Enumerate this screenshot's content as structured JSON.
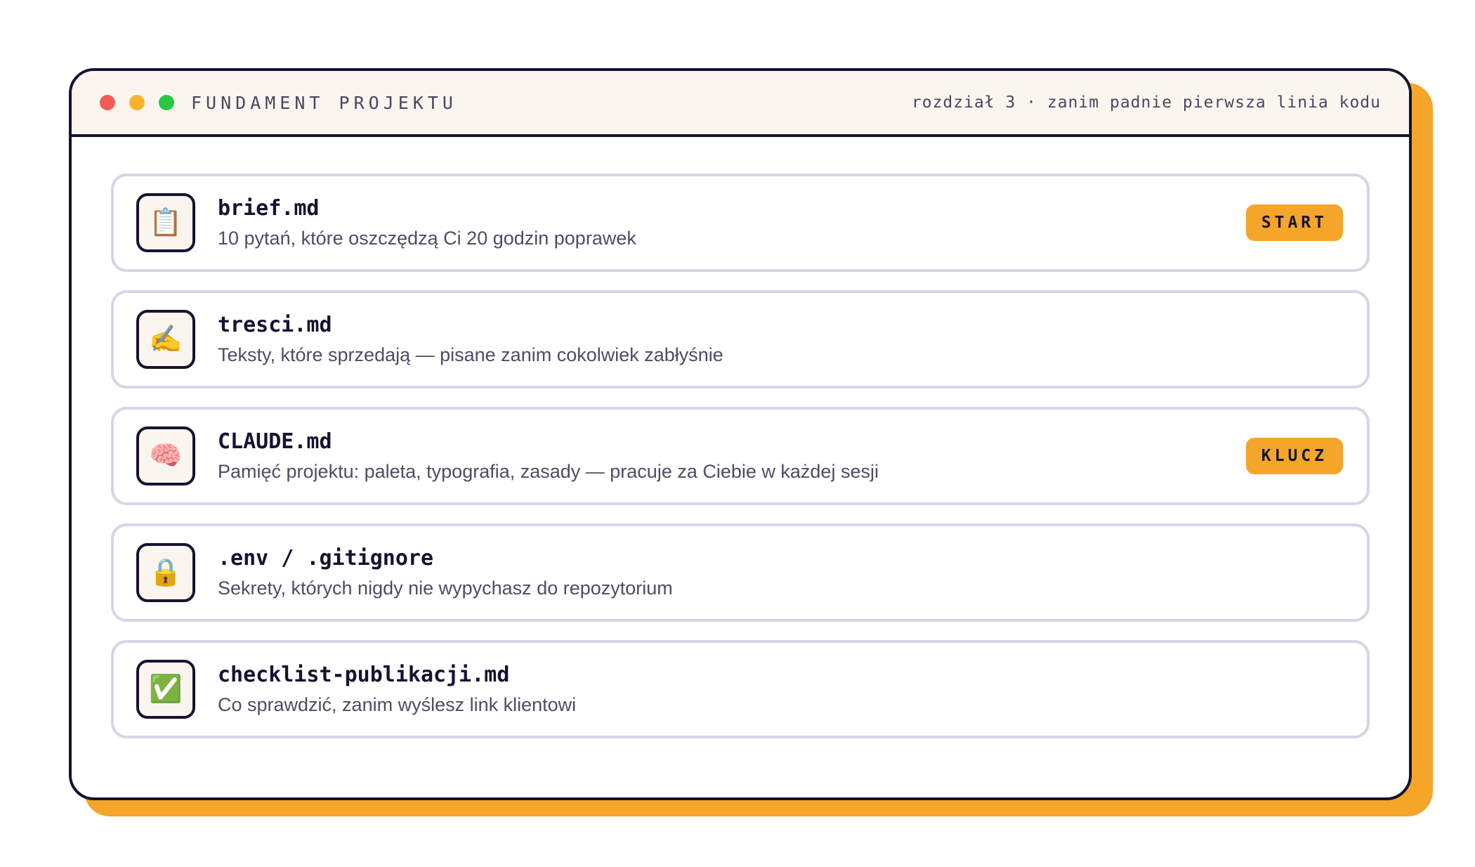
{
  "window": {
    "title": "FUNDAMENT PROJEKTU",
    "subtitle": "rozdział 3 · zanim padnie pierwsza linia kodu",
    "dots": [
      "#f25c54",
      "#f7b32b",
      "#27c93f"
    ]
  },
  "colors": {
    "accent": "#f5a52a",
    "ink": "#161230",
    "card_border": "#d6d4e6",
    "titlebar_bg": "#faf6ef"
  },
  "items": [
    {
      "icon": "clipboard-icon",
      "glyph": "📋",
      "filename": "brief.md",
      "description": "10 pytań, które oszczędzą Ci 20 godzin poprawek",
      "badge": "START"
    },
    {
      "icon": "writing-hand-icon",
      "glyph": "✍️",
      "filename": "tresci.md",
      "description": "Teksty, które sprzedają — pisane zanim cokolwiek zabłyśnie",
      "badge": ""
    },
    {
      "icon": "brain-icon",
      "glyph": "🧠",
      "filename": "CLAUDE.md",
      "description": "Pamięć projektu: paleta, typografia, zasady — pracuje za Ciebie w każdej sesji",
      "badge": "KLUCZ"
    },
    {
      "icon": "lock-icon",
      "glyph": "🔒",
      "filename": ".env / .gitignore",
      "description": "Sekrety, których nigdy nie wypychasz do repozytorium",
      "badge": ""
    },
    {
      "icon": "check-mark-icon",
      "glyph": "✅",
      "filename": "checklist-publikacji.md",
      "description": "Co sprawdzić, zanim wyślesz link klientowi",
      "badge": ""
    }
  ]
}
